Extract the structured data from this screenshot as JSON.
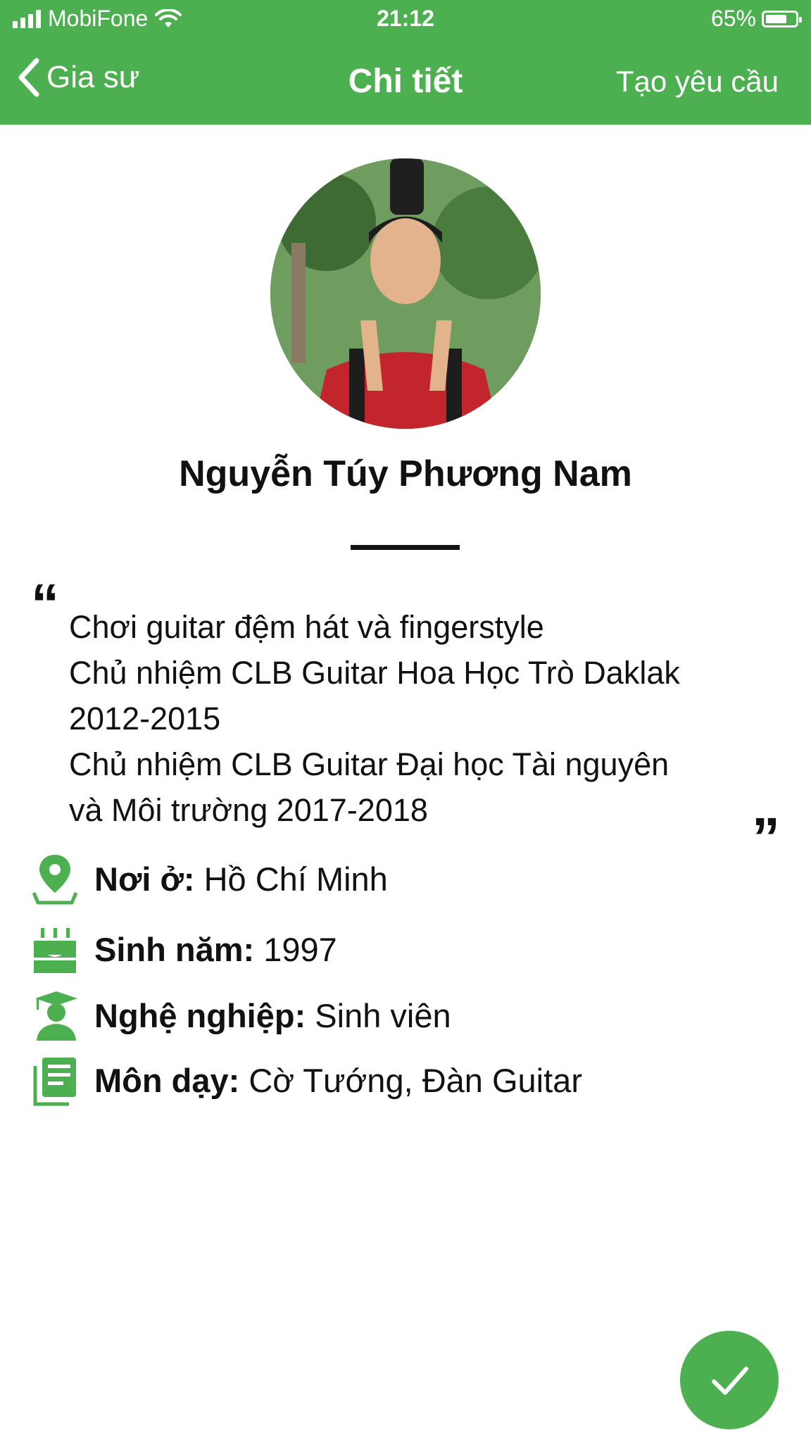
{
  "status_bar": {
    "carrier": "MobiFone",
    "time": "21:12",
    "battery": "65%"
  },
  "nav": {
    "back_label": "Gia sư",
    "title": "Chi tiết",
    "action_label": "Tạo yêu cầu"
  },
  "profile": {
    "name": "Nguyễn Túy Phương Nam",
    "bio_lines": [
      "Chơi guitar đệm hát và fingerstyle",
      "Chủ nhiệm CLB Guitar Hoa Học Trò Daklak",
      "2012-2015",
      "Chủ nhiệm CLB Guitar Đại học Tài nguyên",
      "và Môi trường 2017-2018"
    ],
    "info": [
      {
        "icon": "location-pin-icon",
        "label": "Nơi ở:",
        "value": " Hồ Chí Minh"
      },
      {
        "icon": "birthday-cake-icon",
        "label": "Sinh năm:",
        "value": " 1997"
      },
      {
        "icon": "graduate-icon",
        "label": "Nghệ nghiệp:",
        "value": " Sinh viên"
      },
      {
        "icon": "subjects-book-icon",
        "label": "Môn dạy:",
        "value": " Cờ Tướng, Đàn Guitar"
      }
    ]
  },
  "colors": {
    "primary": "#4caf50",
    "text": "#111111"
  }
}
